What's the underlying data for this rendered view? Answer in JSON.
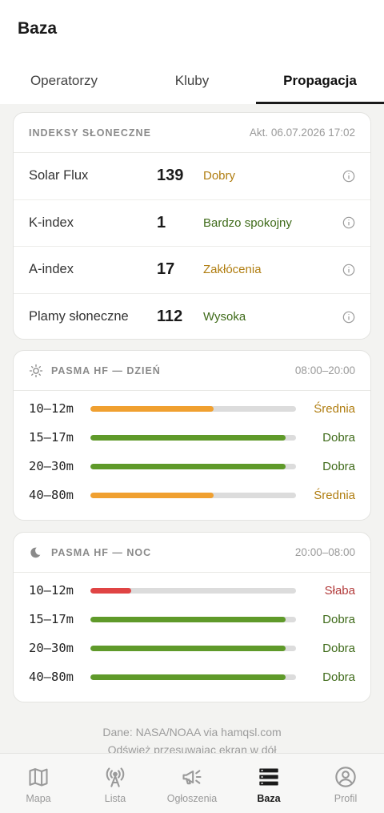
{
  "app": {
    "title": "Baza"
  },
  "tabs": [
    {
      "label": "Operatorzy",
      "active": false
    },
    {
      "label": "Kluby",
      "active": false
    },
    {
      "label": "Propagacja",
      "active": true
    }
  ],
  "indices": {
    "title": "INDEKSY SŁONECZNE",
    "updated": "Akt. 06.07.2026 17:02",
    "rows": [
      {
        "label": "Solar Flux",
        "value": "139",
        "status": "Dobry",
        "status_color": "#b07d10"
      },
      {
        "label": "K-index",
        "value": "1",
        "status": "Bardzo spokojny",
        "status_color": "#3f6b1a"
      },
      {
        "label": "A-index",
        "value": "17",
        "status": "Zakłócenia",
        "status_color": "#b07d10"
      },
      {
        "label": "Plamy słoneczne",
        "value": "112",
        "status": "Wysoka",
        "status_color": "#3f6b1a"
      }
    ]
  },
  "day": {
    "title": "PASMA HF — DZIEŃ",
    "hours": "08:00–20:00",
    "icon": "sun-icon",
    "bands": [
      {
        "label": "10–12m",
        "status": "Średnia",
        "level": 0.6,
        "color": "#f0a030",
        "text_color": "#b07d10"
      },
      {
        "label": "15–17m",
        "status": "Dobra",
        "level": 0.95,
        "color": "#5f9a2a",
        "text_color": "#3f6b1a"
      },
      {
        "label": "20–30m",
        "status": "Dobra",
        "level": 0.95,
        "color": "#5f9a2a",
        "text_color": "#3f6b1a"
      },
      {
        "label": "40–80m",
        "status": "Średnia",
        "level": 0.6,
        "color": "#f0a030",
        "text_color": "#b07d10"
      }
    ]
  },
  "night": {
    "title": "PASMA HF — NOC",
    "hours": "20:00–08:00",
    "icon": "moon-icon",
    "bands": [
      {
        "label": "10–12m",
        "status": "Słaba",
        "level": 0.2,
        "color": "#e04444",
        "text_color": "#b23a3a"
      },
      {
        "label": "15–17m",
        "status": "Dobra",
        "level": 0.95,
        "color": "#5f9a2a",
        "text_color": "#3f6b1a"
      },
      {
        "label": "20–30m",
        "status": "Dobra",
        "level": 0.95,
        "color": "#5f9a2a",
        "text_color": "#3f6b1a"
      },
      {
        "label": "40–80m",
        "status": "Dobra",
        "level": 0.95,
        "color": "#5f9a2a",
        "text_color": "#3f6b1a"
      }
    ]
  },
  "footer": {
    "source": "Dane: NASA/NOAA via hamqsl.com",
    "hint": "Odśwież przesuwając ekran w dół"
  },
  "nav": [
    {
      "label": "Mapa",
      "icon": "map-icon",
      "active": false
    },
    {
      "label": "Lista",
      "icon": "antenna-icon",
      "active": false
    },
    {
      "label": "Ogłoszenia",
      "icon": "megaphone-icon",
      "active": false
    },
    {
      "label": "Baza",
      "icon": "database-icon",
      "active": true
    },
    {
      "label": "Profil",
      "icon": "profile-icon",
      "active": false
    }
  ]
}
